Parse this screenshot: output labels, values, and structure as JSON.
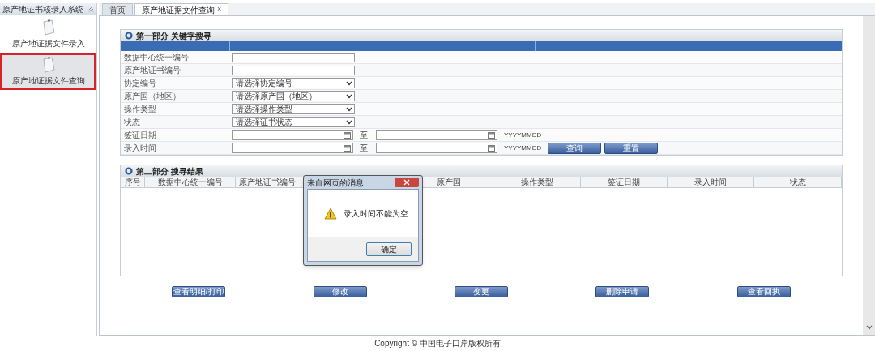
{
  "sidebar": {
    "title": "原产地证书核录入系统",
    "items": [
      {
        "label": "原产地证据文件录入",
        "selected": false
      },
      {
        "label": "原产地证据文件查询",
        "selected": true
      }
    ]
  },
  "tabs": [
    {
      "label": "首页",
      "selected": false
    },
    {
      "label": "原产地证据文件查询",
      "selected": true,
      "close": "×"
    }
  ],
  "search_section": {
    "title": "第一部分 关键字搜寻",
    "fields": [
      {
        "kind": "text",
        "label": "数据中心统一编号"
      },
      {
        "kind": "text",
        "label": "原产地证书编号"
      },
      {
        "kind": "select",
        "label": "协定编号",
        "value": "请选择协定编号"
      },
      {
        "kind": "select",
        "label": "原产国（地区）",
        "value": "请选择原产国（地区）"
      },
      {
        "kind": "select",
        "label": "操作类型",
        "value": "请选择操作类型"
      },
      {
        "kind": "select",
        "label": "状态",
        "value": "请选择证书状态"
      },
      {
        "kind": "date_range",
        "label": "签证日期",
        "separator": "至",
        "format": "YYYYMMDD"
      },
      {
        "kind": "date_range",
        "label": "录入时间",
        "separator": "至",
        "format": "YYYYMMDD"
      }
    ],
    "actions": [
      "查询",
      "重置"
    ]
  },
  "results_section": {
    "title": "第二部分 搜寻结果",
    "columns": [
      "序号",
      "数据中心统一编号",
      "原产地证书编号",
      "原产国",
      "操作类型",
      "签证日期",
      "录入时间",
      "状态"
    ]
  },
  "action_buttons": [
    "查看明细/打印",
    "修改",
    "变更",
    "删除申请",
    "查看回执"
  ],
  "dialog": {
    "title": "来自网页的消息",
    "message": "录入时间不能为空",
    "ok": "确定"
  },
  "footer": "Copyright © 中国电子口岸版权所有"
}
